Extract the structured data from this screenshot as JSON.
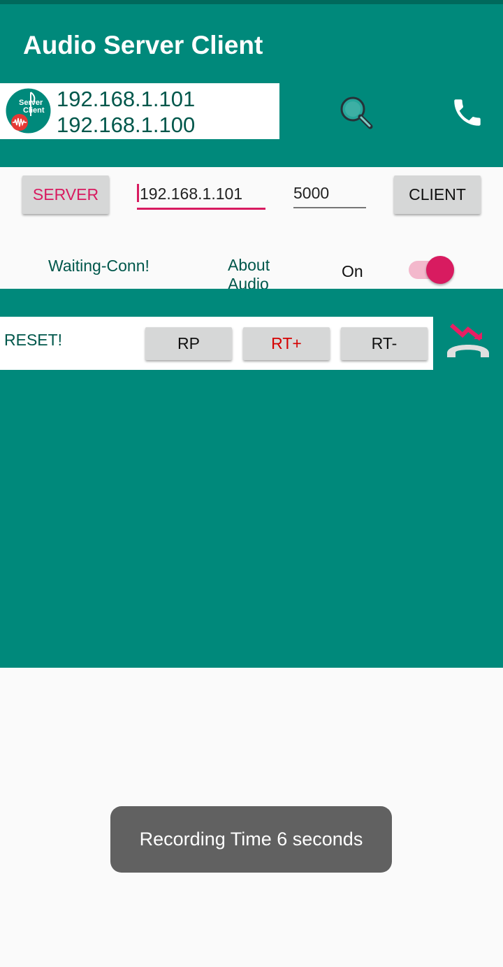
{
  "app": {
    "title": "Audio Server Client",
    "logo_text_top": "Server",
    "logo_text_bottom": "Client"
  },
  "connection": {
    "ip_primary": "192.168.1.101",
    "ip_secondary": "192.168.1.100"
  },
  "controls": {
    "server_label": "SERVER",
    "client_label": "CLIENT",
    "ip_value": "192.168.1.101",
    "port_value": "5000",
    "status_label": "Waiting-Conn!",
    "about_label": "About Audio",
    "switch_label": "On"
  },
  "playback": {
    "reset_label": "RESET!",
    "rp_label": "RP",
    "rt_plus_label": "RT+",
    "rt_minus_label": "RT-"
  },
  "toast": {
    "message": "Recording Time 6 seconds"
  },
  "colors": {
    "primary": "#00897b",
    "primary_dark": "#00695c",
    "accent": "#d81b60",
    "text_teal": "#00574b"
  },
  "icons": {
    "search": "search-icon",
    "phone": "phone-icon",
    "hangup": "hangup-icon",
    "logo": "app-logo-icon"
  }
}
